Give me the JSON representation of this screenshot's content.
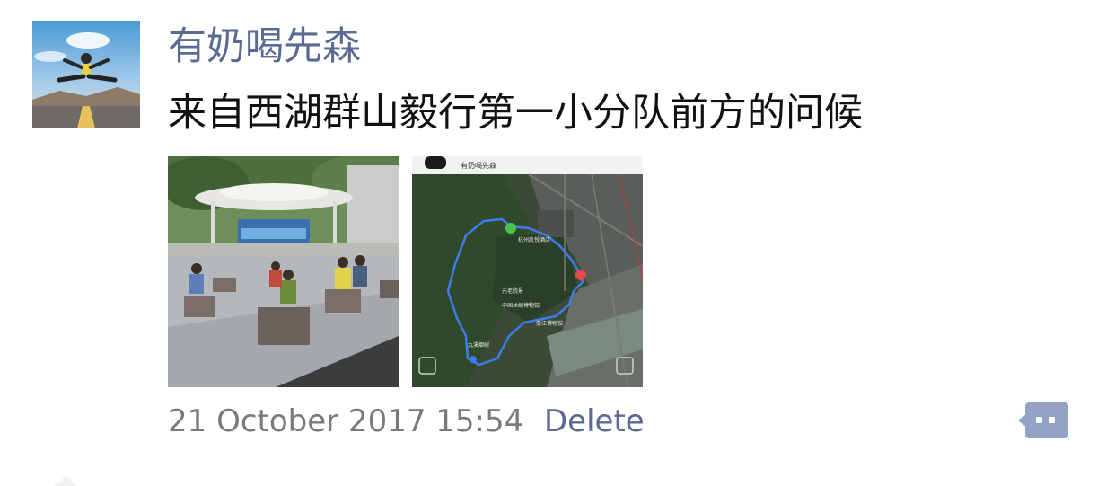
{
  "post": {
    "username": "有奶喝先森",
    "text": "来自西湖群山毅行第一小分队前方的问候",
    "timestamp": "21 October 2017 15:54",
    "delete_label": "Delete"
  },
  "icons": {
    "avatar": "avatar-person-jumping-on-road",
    "comment": "comment-more-icon"
  },
  "photos": [
    {
      "subject": "group-photo-at-plaza"
    },
    {
      "subject": "hiking-route-map",
      "map_header_text": "有奶喝先森",
      "map_labels": [
        "杭州凯悦酒店",
        "元老院景",
        "中国丝绸博物馆",
        "九溪烟树",
        "浙江博物馆"
      ]
    }
  ],
  "colors": {
    "username": "#5b6a92",
    "text": "#111111",
    "timestamp": "#7a7a7a",
    "delete": "#5b6a92",
    "comment_button": "#93a3c6",
    "route_line": "#3d7cf0"
  }
}
